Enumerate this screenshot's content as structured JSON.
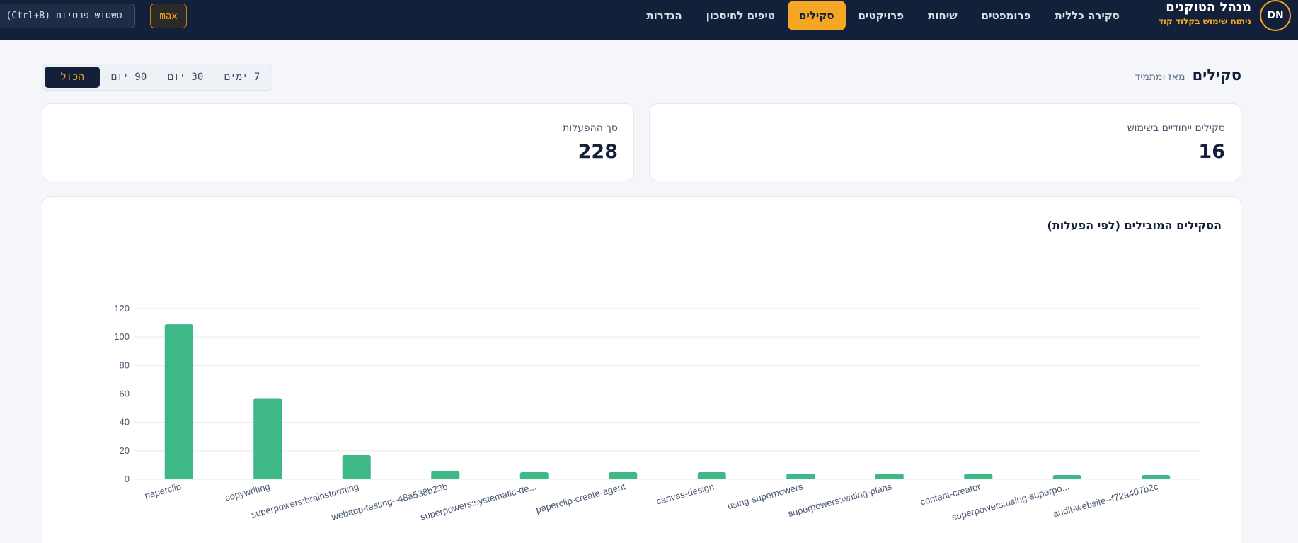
{
  "nav": {
    "avatar_initials": "DN",
    "brand_title": "מנהל הטוקנים",
    "brand_subtitle": "ניתוח שימוש בקלוד קוד",
    "items": [
      {
        "label": "סקירה כללית",
        "active": false
      },
      {
        "label": "פרומפטים",
        "active": false
      },
      {
        "label": "שיחות",
        "active": false
      },
      {
        "label": "פרויקטים",
        "active": false
      },
      {
        "label": "סקילים",
        "active": true
      },
      {
        "label": "טיפים לחיסכון",
        "active": false
      },
      {
        "label": "הגדרות",
        "active": false
      }
    ],
    "max_label": "max",
    "blur_label": "טשטוש פרטיות (Ctrl+B)"
  },
  "page": {
    "title": "סקילים",
    "subtitle": "מאז ומתמיד",
    "ranges": [
      {
        "label": "7 ימים",
        "active": false
      },
      {
        "label": "30 יום",
        "active": false
      },
      {
        "label": "90 יום",
        "active": false
      },
      {
        "label": "הכול",
        "active": true
      }
    ]
  },
  "stats": {
    "unique_label": "סקילים ייחודיים בשימוש",
    "unique_value": "16",
    "total_label": "סך ההפעלות",
    "total_value": "228"
  },
  "chart_title": "הסקילים המובילים (לפי הפעלות)",
  "chart_data": {
    "type": "bar",
    "categories": [
      "paperclip",
      "copywriting",
      "superpowers:brainstorming",
      "webapp-testing--48a538b23b",
      "superpowers:systematic-de...",
      "paperclip-create-agent",
      "canvas-design",
      "using-superpowers",
      "superpowers:writing-plans",
      "content-creator",
      "superpowers:using-superpo...",
      "audit-website--f72a407b2c"
    ],
    "values": [
      109,
      57,
      17,
      6,
      5,
      5,
      5,
      4,
      4,
      4,
      3,
      3
    ],
    "ylim": [
      0,
      120
    ],
    "yticks": [
      0,
      20,
      40,
      60,
      80,
      100,
      120
    ],
    "bar_color": "#3fb888",
    "grid": true
  },
  "colors": {
    "nav_bg": "#13203a",
    "accent": "#f5a623",
    "page_bg": "#f4f6f9"
  }
}
